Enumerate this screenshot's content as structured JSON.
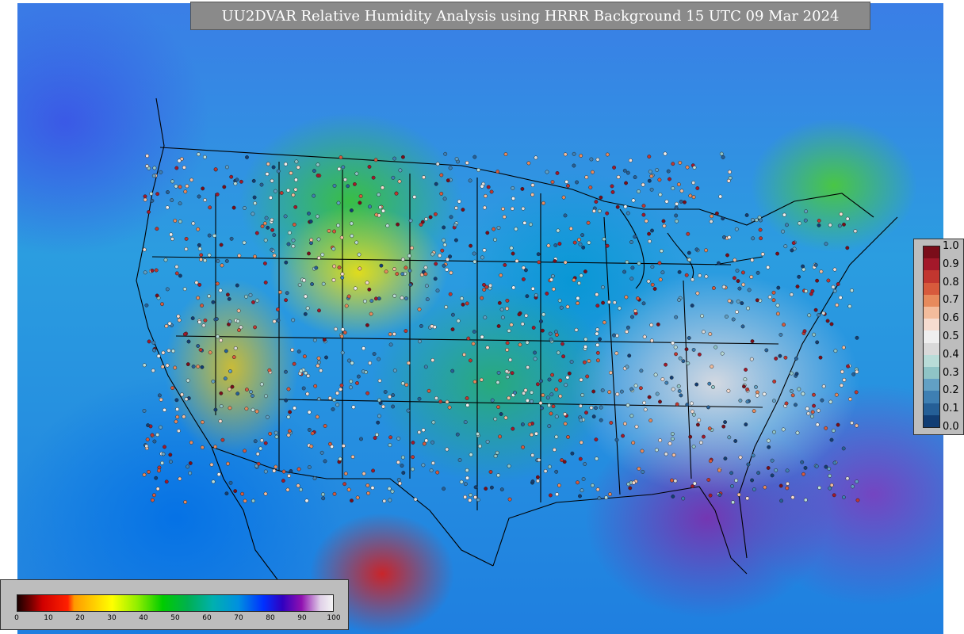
{
  "title": "UU2DVAR Relative Humidity Analysis using HRRR Background 15 UTC 09 Mar 2024",
  "observation_colorbar": {
    "ticks": [
      "1.0",
      "0.9",
      "0.8",
      "0.7",
      "0.6",
      "0.5",
      "0.4",
      "0.3",
      "0.2",
      "0.1",
      "0.0"
    ],
    "colors": [
      "#7a0d1a",
      "#a3182a",
      "#c2362f",
      "#d75a3c",
      "#e78a5c",
      "#f3bc9c",
      "#f6dcd0",
      "#efefef",
      "#d9d9d9",
      "#b9dcd8",
      "#8fc4c6",
      "#62a0c4",
      "#3e7fb3",
      "#255f97",
      "#113d74"
    ]
  },
  "analysis_colorbar": {
    "ticks": [
      "0",
      "10",
      "20",
      "30",
      "40",
      "50",
      "60",
      "70",
      "80",
      "90",
      "100"
    ],
    "stops": [
      {
        "v": 0,
        "c": "#1a0000"
      },
      {
        "v": 4,
        "c": "#6e0000"
      },
      {
        "v": 8,
        "c": "#d00000"
      },
      {
        "v": 16,
        "c": "#ff2000"
      },
      {
        "v": 18,
        "c": "#ff9900"
      },
      {
        "v": 24,
        "c": "#ffcc00"
      },
      {
        "v": 30,
        "c": "#ffff00"
      },
      {
        "v": 38,
        "c": "#90ee00"
      },
      {
        "v": 46,
        "c": "#00cc00"
      },
      {
        "v": 54,
        "c": "#00b050"
      },
      {
        "v": 62,
        "c": "#00b0b0"
      },
      {
        "v": 70,
        "c": "#0090e0"
      },
      {
        "v": 78,
        "c": "#0030ff"
      },
      {
        "v": 84,
        "c": "#3000c0"
      },
      {
        "v": 90,
        "c": "#9010b0"
      },
      {
        "v": 96,
        "c": "#e0d0e8"
      },
      {
        "v": 100,
        "c": "#f4f4f4"
      }
    ]
  }
}
